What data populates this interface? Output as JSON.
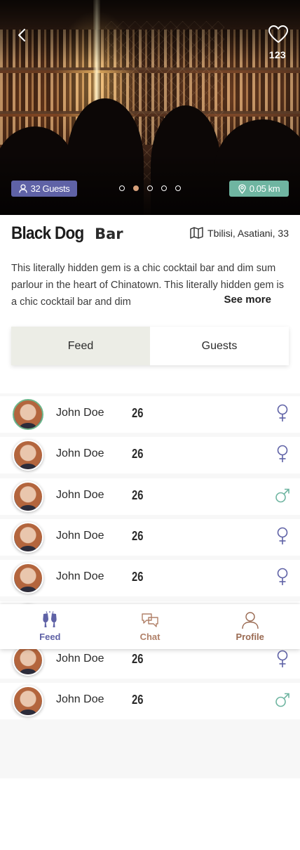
{
  "hero": {
    "like_count": "123",
    "guests_badge": "32 Guests",
    "distance_badge": "0.05 km",
    "slides_total": 5,
    "active_slide_index": 1
  },
  "venue": {
    "name": "Black Dog",
    "type": "Bar",
    "address": "Tbilisi, Asatiani, 33",
    "description": "This literally hidden gem is a chic cocktail bar and dim sum parlour in the heart of Chinatown. This literally hidden gem is a chic cocktail bar and dim",
    "see_more_label": "See more"
  },
  "tabs": [
    {
      "label": "Feed",
      "active": true
    },
    {
      "label": "Guests",
      "active": false
    }
  ],
  "guests": [
    {
      "name": "John Doe",
      "age": "26",
      "gender": "female",
      "highlight": true
    },
    {
      "name": "John Doe",
      "age": "26",
      "gender": "female"
    },
    {
      "name": "John Doe",
      "age": "26",
      "gender": "male"
    },
    {
      "name": "John Doe",
      "age": "26",
      "gender": "female"
    },
    {
      "name": "John Doe",
      "age": "26",
      "gender": "female"
    },
    {
      "name": "John Doe",
      "age": "26",
      "gender": "female"
    },
    {
      "name": "John Doe",
      "age": "26",
      "gender": "female"
    },
    {
      "name": "John Doe",
      "age": "26",
      "gender": "male"
    }
  ],
  "bottom_nav": [
    {
      "label": "Feed",
      "icon": "cheers-glasses-icon",
      "active": true
    },
    {
      "label": "Chat",
      "icon": "chat-bubbles-icon"
    },
    {
      "label": "Profile",
      "icon": "person-icon"
    }
  ],
  "colors": {
    "accent_purple": "#5f62a6",
    "accent_teal": "#6fb5a1",
    "female_icon": "#5f62a6",
    "male_icon": "#6fb5a1",
    "tab_active_bg": "#ecede6"
  }
}
